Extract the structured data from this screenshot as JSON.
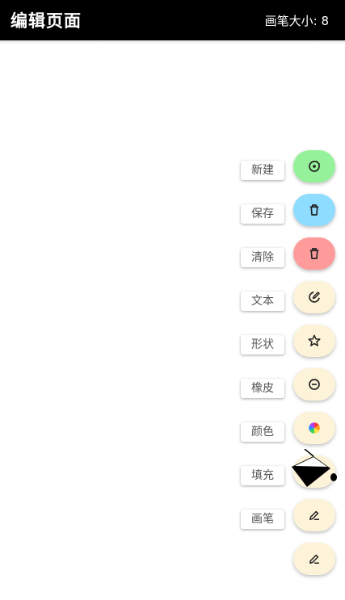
{
  "header": {
    "title": "编辑页面",
    "brush_size": "画笔大小: 8"
  },
  "menu": [
    {
      "label": "新建",
      "icon": "new-icon",
      "color": "#96f29a"
    },
    {
      "label": "保存",
      "icon": "save-icon",
      "color": "#8edcff"
    },
    {
      "label": "清除",
      "icon": "clear-icon",
      "color": "#ff9b9b"
    },
    {
      "label": "文本",
      "icon": "text-icon",
      "color": "#fdf3d8"
    },
    {
      "label": "形状",
      "icon": "shape-star-icon",
      "color": "#fdf3d8"
    },
    {
      "label": "橡皮",
      "icon": "eraser-icon",
      "color": "#fdf3d8"
    },
    {
      "label": "颜色",
      "icon": "color-wheel-icon",
      "color": "#fdf3d8"
    },
    {
      "label": "填充",
      "icon": "fill-bucket-icon",
      "color": "#fdf3d8"
    },
    {
      "label": "画笔",
      "icon": "brush-pen-icon",
      "color": "#fdf3d8"
    }
  ],
  "main_fab": {
    "icon": "pen-icon",
    "color": "#fdf3d8"
  }
}
